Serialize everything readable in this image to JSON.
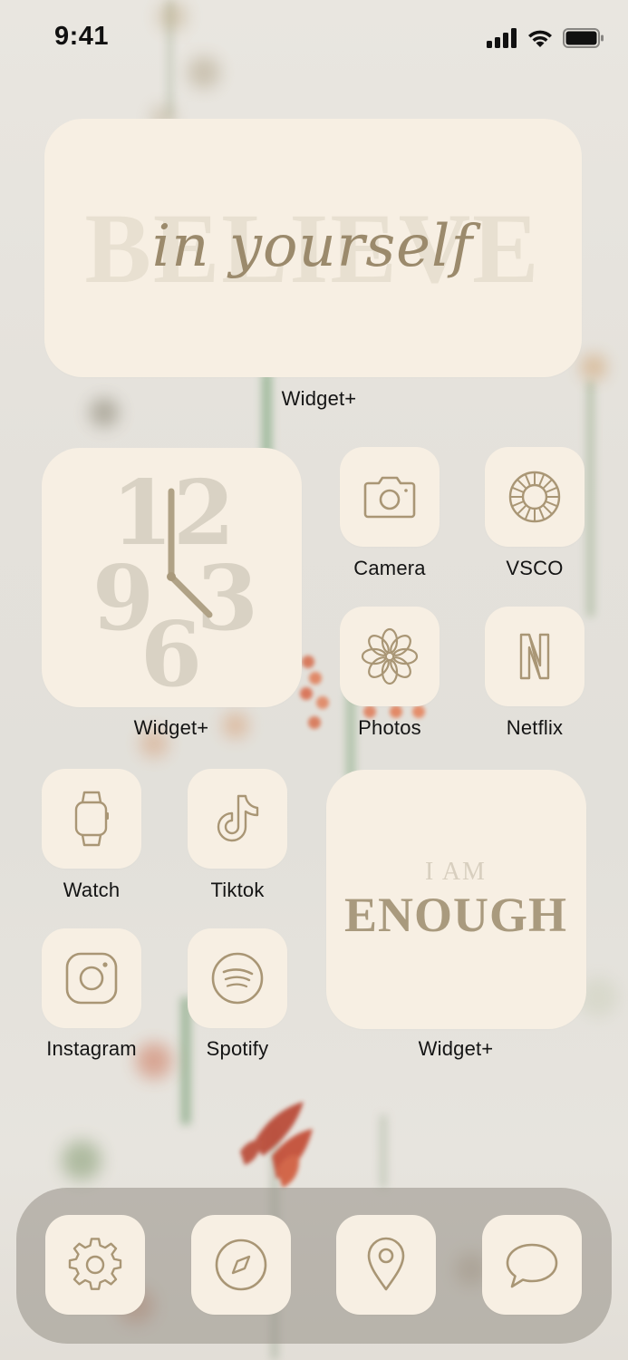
{
  "status_bar": {
    "time": "9:41"
  },
  "widgets": {
    "believe": {
      "big_text": "BELIEVE",
      "script_text": "in yourself",
      "label": "Widget+"
    },
    "clock": {
      "numerals": [
        "12",
        "9",
        "3",
        "6"
      ],
      "label": "Widget+"
    },
    "enough": {
      "line1": "I AM",
      "line2": "ENOUGH",
      "label": "Widget+"
    }
  },
  "apps": {
    "camera": {
      "label": "Camera",
      "icon": "camera-icon"
    },
    "vsco": {
      "label": "VSCO",
      "icon": "vsco-icon"
    },
    "photos": {
      "label": "Photos",
      "icon": "flower-icon"
    },
    "netflix": {
      "label": "Netflix",
      "icon": "netflix-icon"
    },
    "watch": {
      "label": "Watch",
      "icon": "watch-icon"
    },
    "tiktok": {
      "label": "Tiktok",
      "icon": "tiktok-icon"
    },
    "instagram": {
      "label": "Instagram",
      "icon": "instagram-icon"
    },
    "spotify": {
      "label": "Spotify",
      "icon": "spotify-icon"
    }
  },
  "dock": {
    "items": [
      {
        "icon": "settings-icon"
      },
      {
        "icon": "compass-icon"
      },
      {
        "icon": "location-pin-icon"
      },
      {
        "icon": "message-icon"
      }
    ]
  },
  "colors": {
    "tile_background": "#f7efe3",
    "icon_stroke": "#a99675",
    "label_text": "#141414",
    "widget_text_light": "#e5dccd",
    "widget_text_dark": "#a99a7e"
  }
}
